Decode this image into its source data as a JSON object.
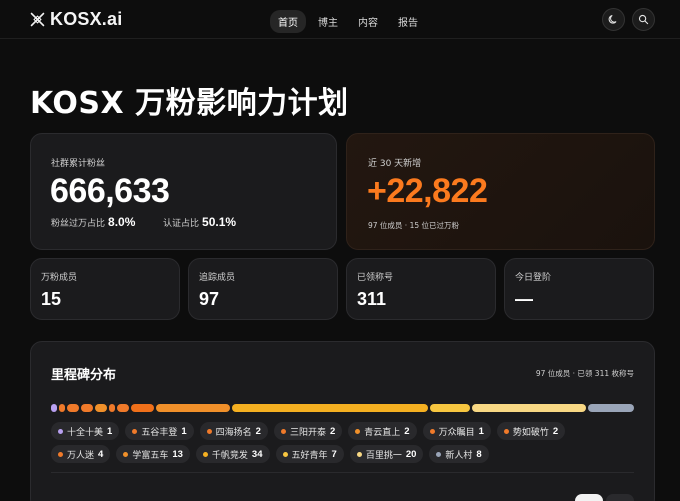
{
  "brand": {
    "name": "KOSX.ai"
  },
  "nav": {
    "links": [
      {
        "label": "首页",
        "active": true
      },
      {
        "label": "博主"
      },
      {
        "label": "内容"
      },
      {
        "label": "报告"
      }
    ],
    "icons": [
      "moon-icon",
      "search-icon"
    ]
  },
  "page": {
    "title": "KOSX 万粉影响力计划"
  },
  "summary": {
    "label": "社群累计粉丝",
    "value": "666,633",
    "ratio1_label": "粉丝过万占比",
    "ratio1_value": "8.0%",
    "ratio2_label": "认证占比",
    "ratio2_value": "50.1%"
  },
  "recent": {
    "label": "近 30 天新增",
    "value": "+22,822",
    "note": "97 位成员 · 15 位已过万粉"
  },
  "stats": [
    {
      "label": "万粉成员",
      "value": "15"
    },
    {
      "label": "追踪成员",
      "value": "97"
    },
    {
      "label": "已领称号",
      "value": "311"
    },
    {
      "label": "今日登阶",
      "value": "—"
    }
  ],
  "milestone": {
    "title": "里程碑分布",
    "meta": "97 位成员 · 已领 311 枚称号",
    "legend_row1": [
      {
        "name": "十全十美",
        "count": "1",
        "color": "#b8a0f0"
      },
      {
        "name": "五谷丰登",
        "count": "1",
        "color": "#f07a2a"
      },
      {
        "name": "四海扬名",
        "count": "2",
        "color": "#f07a2a"
      },
      {
        "name": "三阳开泰",
        "count": "2",
        "color": "#f07a2a"
      },
      {
        "name": "青云直上",
        "count": "2",
        "color": "#f0902a"
      },
      {
        "name": "万众瞩目",
        "count": "1",
        "color": "#f07a2a"
      },
      {
        "name": "势如破竹",
        "count": "2",
        "color": "#f07a2a"
      }
    ],
    "legend_row2": [
      {
        "name": "万人迷",
        "count": "4",
        "color": "#f07a2a"
      },
      {
        "name": "学富五车",
        "count": "13",
        "color": "#f0902a"
      },
      {
        "name": "千帆竞发",
        "count": "34",
        "color": "#f5b021"
      },
      {
        "name": "五好青年",
        "count": "7",
        "color": "#f7c640"
      },
      {
        "name": "百里挑一",
        "count": "20",
        "color": "#f8d884"
      },
      {
        "name": "新人村",
        "count": "8",
        "color": "#9aa5b8"
      }
    ],
    "bar_segments": [
      {
        "count": 1,
        "color": "#b8a0f0"
      },
      {
        "count": 1,
        "color": "#f07a2a"
      },
      {
        "count": 2,
        "color": "#f07a2a"
      },
      {
        "count": 2,
        "color": "#f07a2a"
      },
      {
        "count": 2,
        "color": "#f0902a"
      },
      {
        "count": 1,
        "color": "#f07a2a"
      },
      {
        "count": 2,
        "color": "#f07a2a"
      },
      {
        "count": 4,
        "color": "#f0701a"
      },
      {
        "count": 13,
        "color": "#f0902a"
      },
      {
        "count": 34,
        "color": "#f5b021"
      },
      {
        "count": 7,
        "color": "#f7c640"
      },
      {
        "count": 20,
        "color": "#f8d884"
      },
      {
        "count": 8,
        "color": "#9aa5b8"
      }
    ]
  }
}
